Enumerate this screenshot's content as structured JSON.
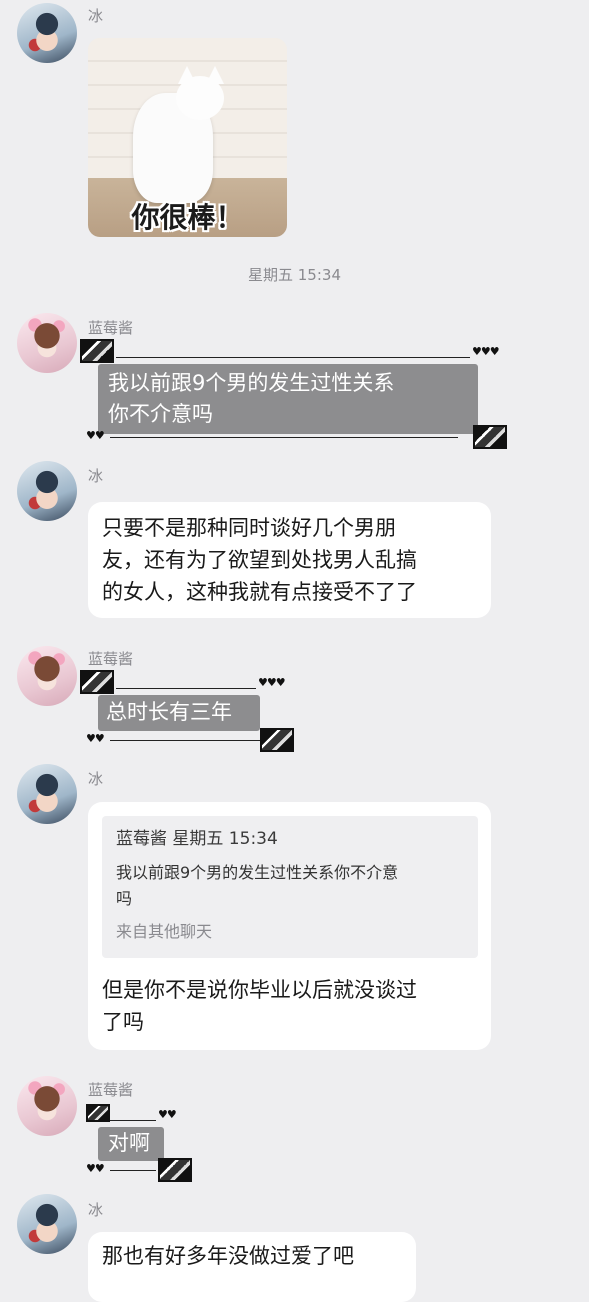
{
  "messages": {
    "m1": {
      "sender": "冰",
      "sticker_caption": "你很棒！"
    },
    "time1": "星期五 15:34",
    "m2": {
      "sender": "蓝莓酱",
      "line1": "我以前跟9个男的发生过性关系",
      "line2": "你不介意吗"
    },
    "m3": {
      "sender": "冰",
      "line1": "只要不是那种同时谈好几个男朋",
      "line2": "友，还有为了欲望到处找男人乱搞",
      "line3": "的女人，这种我就有点接受不了了"
    },
    "m4": {
      "sender": "蓝莓酱",
      "text": "总时长有三年"
    },
    "m5": {
      "sender": "冰",
      "quote_header": "蓝莓酱 星期五 15:34",
      "quote_line1": "我以前跟9个男的发生过性关系你不介意",
      "quote_line2": "吗",
      "quote_source": "来自其他聊天",
      "line1": "但是你不是说你毕业以后就没谈过",
      "line2": "了吗"
    },
    "m6": {
      "sender": "蓝莓酱",
      "text": "对啊"
    },
    "m7": {
      "sender": "冰",
      "text": "那也有好多年没做过爱了吧"
    }
  },
  "colors": {
    "background": "#eeeef0",
    "bubble": "#ffffff",
    "deco_bubble": "#8d8d8f",
    "meta_text": "#8a8a8f"
  }
}
